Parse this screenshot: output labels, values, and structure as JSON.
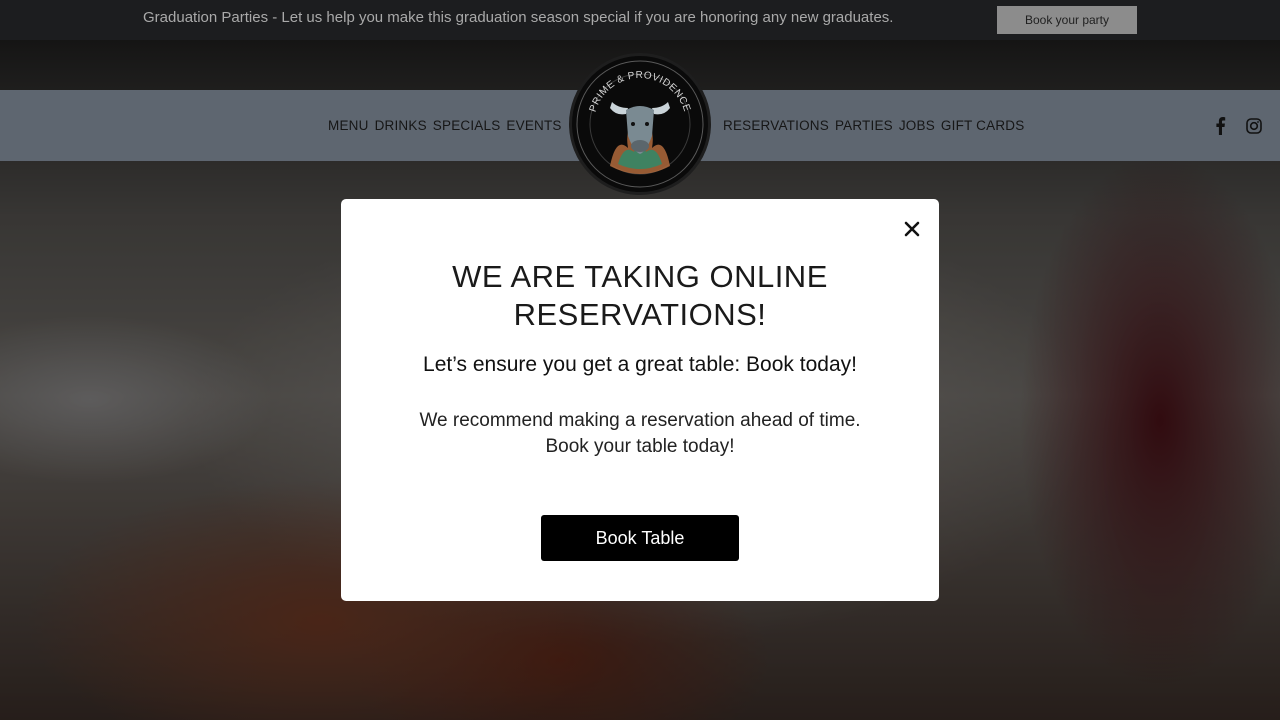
{
  "announcement": {
    "text": "Graduation Parties - Let us help you make this graduation season special if you are honoring any new graduates.",
    "button_label": "Book your party"
  },
  "nav": {
    "left": [
      "MENU",
      "DRINKS",
      "SPECIALS",
      "EVENTS"
    ],
    "right": [
      "RESERVATIONS",
      "PARTIES",
      "JOBS",
      "GIFT CARDS"
    ]
  },
  "logo": {
    "text": "PRIME & PROVIDENCE",
    "icon": "bull-head-logo"
  },
  "social": {
    "facebook_icon": "facebook-icon",
    "instagram_icon": "instagram-icon"
  },
  "modal": {
    "title_line1": "WE ARE TAKING ONLINE",
    "title_line2": "RESERVATIONS!",
    "subtitle": "Let’s ensure you get a great table: Book today!",
    "body_line1": "We recommend making a reservation ahead of time.",
    "body_line2": "Book your table today!",
    "button_label": "Book Table",
    "close_icon": "close-icon"
  },
  "colors": {
    "announce_bg": "#1c1d1f",
    "header_bg": "#5e6670",
    "button_bg": "#000000",
    "modal_bg": "#ffffff"
  }
}
